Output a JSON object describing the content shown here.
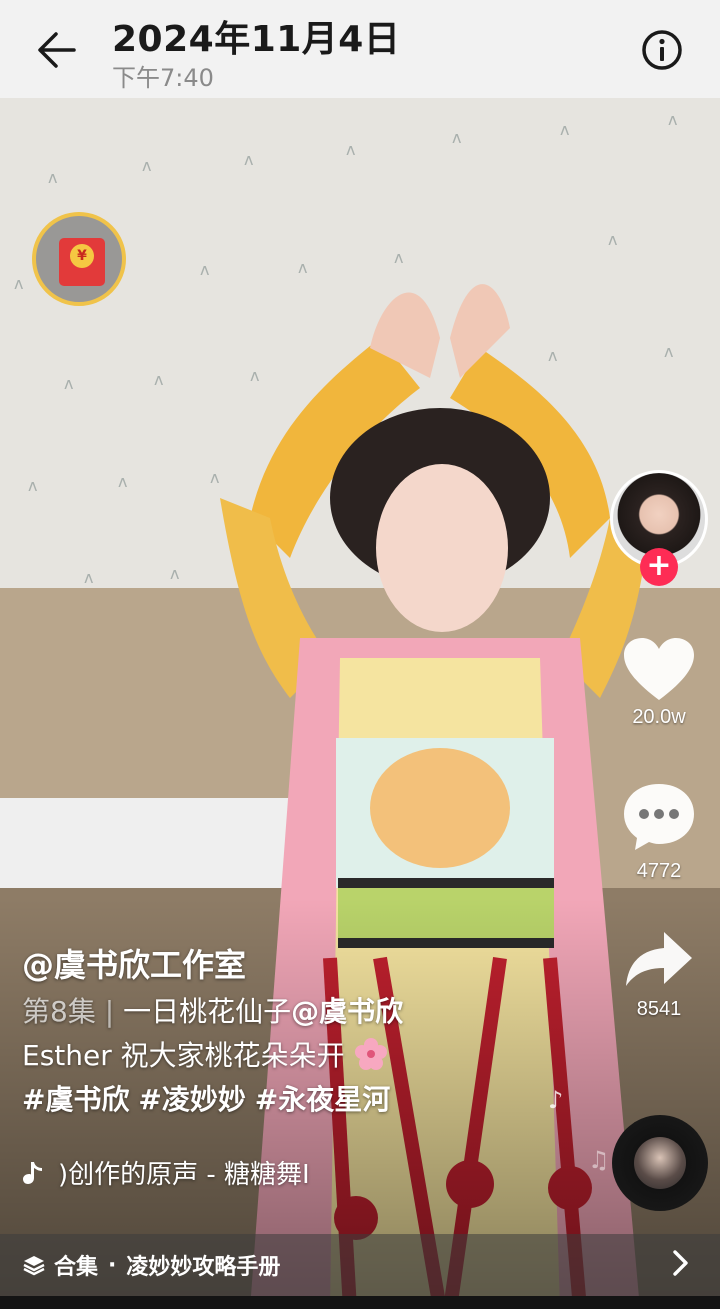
{
  "header": {
    "title": "2024年11月4日",
    "subtitle": "下午7:40"
  },
  "video": {
    "author": "@虞书欣工作室",
    "episode": "第8集",
    "separator": "|",
    "caption_text": "一日桃花仙子",
    "mention": "@虞书欣",
    "caption_line2": "Esther 祝大家桃花朵朵开",
    "hashtags": [
      "#虞书欣",
      "#凌妙妙",
      "#永夜星河"
    ],
    "music": ")创作的原声 - 糖糖舞I"
  },
  "actions": {
    "like_count": "20.0w",
    "comment_count": "4772",
    "share_count": "8541"
  },
  "collection": {
    "prefix": "合集",
    "dot": "·",
    "name": "凌妙妙攻略手册"
  },
  "colors": {
    "topbar_bg": "#f2f2f2",
    "follow_red": "#fe2c55",
    "red_packet_ring": "#f0c34a"
  }
}
